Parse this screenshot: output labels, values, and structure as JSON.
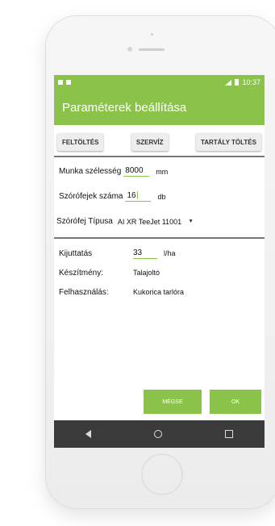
{
  "status_bar": {
    "time": "10:37"
  },
  "appbar": {
    "title": "Paraméterek beállítása"
  },
  "tabs": [
    {
      "label": "FELTÖLTÉS"
    },
    {
      "label": "SZERVÍZ"
    },
    {
      "label": "TARTÁLY TÖLTÉS"
    }
  ],
  "form": {
    "work_width": {
      "label": "Munka szélesség",
      "value": "8000",
      "unit": "mm"
    },
    "nozzle_count": {
      "label": "Szórófejek száma",
      "value": "16",
      "unit": "db"
    },
    "nozzle_type": {
      "label": "Szórófej Típusa",
      "selected": "AI XR TeeJet 11001"
    }
  },
  "details": {
    "application": {
      "label": "Kijuttatás",
      "value": "33",
      "unit": "l/ha"
    },
    "product": {
      "label": "Készítmény:",
      "value": "Talajoltó"
    },
    "usage": {
      "label": "Felhasználás:",
      "value": "Kukorica tarlóra"
    }
  },
  "actions": {
    "cancel": "MÉGSE",
    "ok": "OK"
  },
  "colors": {
    "accent": "#8bc34a",
    "navbar": "#3b3b3b",
    "divider": "#777777"
  },
  "icons": [
    "signal-icon",
    "battery-icon",
    "back-icon",
    "home-icon",
    "recents-icon",
    "dropdown-caret-icon"
  ]
}
